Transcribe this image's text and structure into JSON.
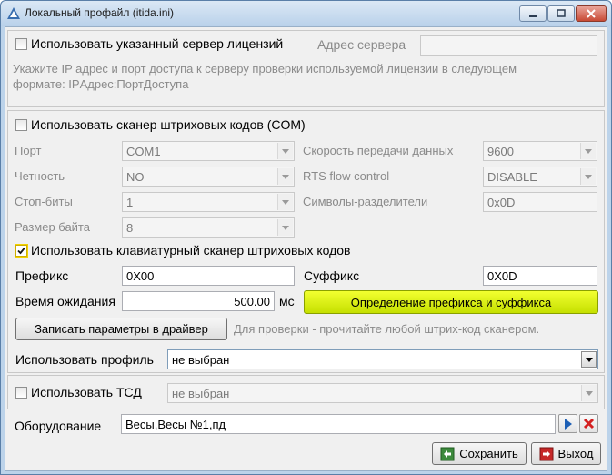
{
  "window": {
    "title": "Локальный профайл (itida.ini)"
  },
  "license": {
    "checkbox_label": "Использовать указанный сервер лицензий",
    "checked": false,
    "address_label": "Адрес сервера",
    "address_value": "",
    "hint_line1": "Укажите IP адрес и порт доступа к серверу проверки используемой лицензии в следующем",
    "hint_line2": "формате: IPАдрес:ПортДоступа"
  },
  "com_scanner": {
    "checkbox_label": "Использовать сканер штриховых кодов (COM)",
    "checked": false,
    "port_label": "Порт",
    "port_value": "COM1",
    "parity_label": "Четность",
    "parity_value": "NO",
    "stopbits_label": "Стоп-биты",
    "stopbits_value": "1",
    "bytesize_label": "Размер байта",
    "bytesize_value": "8",
    "baud_label": "Скорость передачи данных",
    "baud_value": "9600",
    "rts_label": "RTS flow control",
    "rts_value": "DISABLE",
    "sep_label": "Символы-разделители",
    "sep_value": "0x0D"
  },
  "kbd_scanner": {
    "checkbox_label": "Использовать клавиатурный сканер штриховых кодов",
    "checked": true,
    "prefix_label": "Префикс",
    "prefix_value": "0X00",
    "suffix_label": "Суффикс",
    "suffix_value": "0X0D",
    "timeout_label": "Время ожидания",
    "timeout_value": "500.00",
    "timeout_unit": "мс",
    "detect_button": "Определение префикса и суффикса",
    "write_button": "Записать параметры в драйвер",
    "check_hint": "Для проверки - прочитайте любой штрих-код сканером."
  },
  "profile": {
    "label": "Использовать профиль",
    "value": "не выбран"
  },
  "tsd": {
    "checkbox_label": "Использовать ТСД",
    "checked": false,
    "value": "не выбран"
  },
  "equipment": {
    "label": "Оборудование",
    "value": "Весы,Весы №1,пд"
  },
  "footer": {
    "save_button": "Сохранить",
    "exit_button": "Выход"
  },
  "colors": {
    "accent_button": "#dff000",
    "title_gradient": "#b9d1ea",
    "close_button": "#c84a35"
  }
}
